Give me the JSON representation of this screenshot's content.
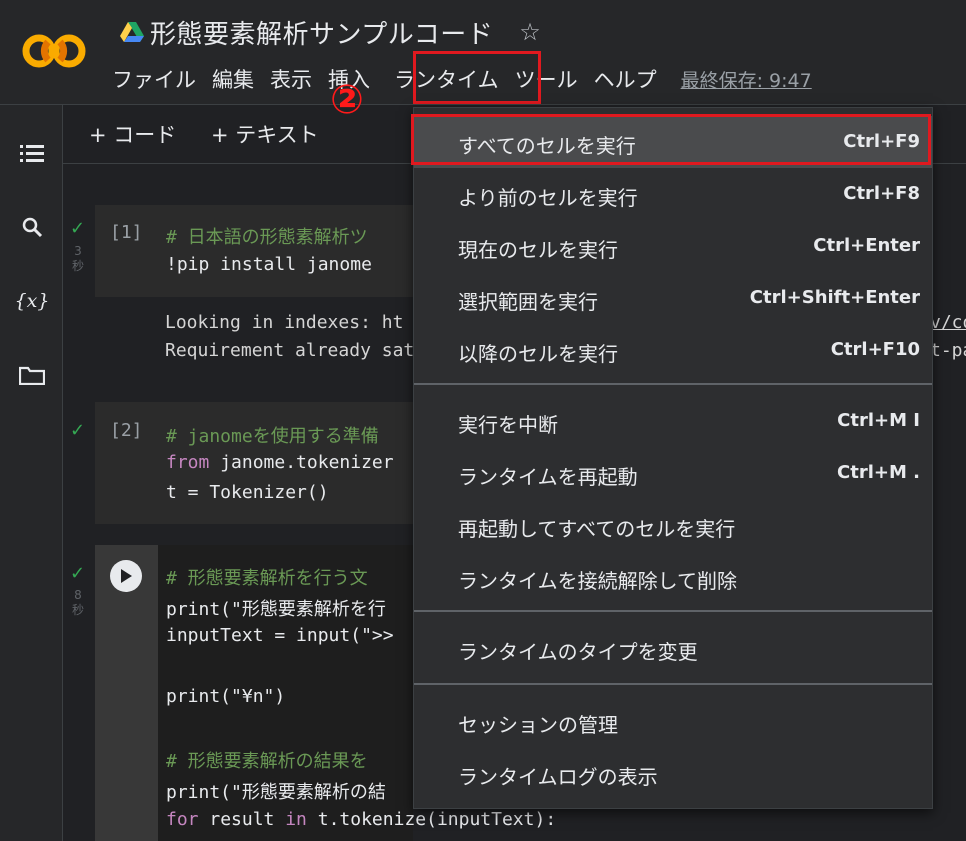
{
  "app": {
    "title": "形態要素解析サンプルコード",
    "logo_text": "CO",
    "last_saved": "最終保存: 9:47",
    "step_marker": "②"
  },
  "menubar": {
    "items": [
      "ファイル",
      "編集",
      "表示",
      "挿入",
      "ランタイム",
      "ツール",
      "ヘルプ"
    ],
    "active": "ランタイム"
  },
  "toolbar": {
    "add_code": "+ コード",
    "add_text": "+ テキスト"
  },
  "cells": [
    {
      "number": "[1]",
      "exec_time": [
        "3",
        "秒"
      ],
      "lines": [
        "# 日本語の形態素解析ツ",
        "!pip install janome"
      ],
      "output": [
        "Looking in indexes: ht",
        "Requirement already sat"
      ],
      "output_right": [
        "v/co",
        "t-pa"
      ]
    },
    {
      "number": "[2]",
      "lines": [
        "# janomeを使用する準備",
        "from",
        " janome.tokenizer",
        "t = Tokenizer()"
      ]
    },
    {
      "exec_time": [
        "8",
        "秒"
      ],
      "lines": [
        "# 形態要素解析を行う文",
        "print(\"形態要素解析を行",
        "inputText = input(\">>",
        "print(\"¥n\")",
        "# 形態要素解析の結果を",
        "print(\"形態要素解析の結",
        "for",
        " result ",
        "in",
        " t.tokenize(inputText):"
      ]
    }
  ],
  "runtime_menu": {
    "groups": [
      [
        {
          "label": "すべてのセルを実行",
          "shortcut": "Ctrl+F9",
          "hovered": true
        },
        {
          "label": "より前のセルを実行",
          "shortcut": "Ctrl+F8"
        },
        {
          "label": "現在のセルを実行",
          "shortcut": "Ctrl+Enter"
        },
        {
          "label": "選択範囲を実行",
          "shortcut": "Ctrl+Shift+Enter"
        },
        {
          "label": "以降のセルを実行",
          "shortcut": "Ctrl+F10"
        }
      ],
      [
        {
          "label": "実行を中断",
          "shortcut": "Ctrl+M I"
        },
        {
          "label": "ランタイムを再起動",
          "shortcut": "Ctrl+M ."
        },
        {
          "label": "再起動してすべてのセルを実行",
          "shortcut": ""
        },
        {
          "label": "ランタイムを接続解除して削除",
          "shortcut": ""
        }
      ],
      [
        {
          "label": "ランタイムのタイプを変更",
          "shortcut": ""
        }
      ],
      [
        {
          "label": "セッションの管理",
          "shortcut": ""
        },
        {
          "label": "ランタイムログの表示",
          "shortcut": ""
        }
      ]
    ]
  },
  "colors": {
    "highlight_box": "#e0191f",
    "check": "#34a853",
    "comment": "#6a9955",
    "keyword": "#c586c0"
  }
}
